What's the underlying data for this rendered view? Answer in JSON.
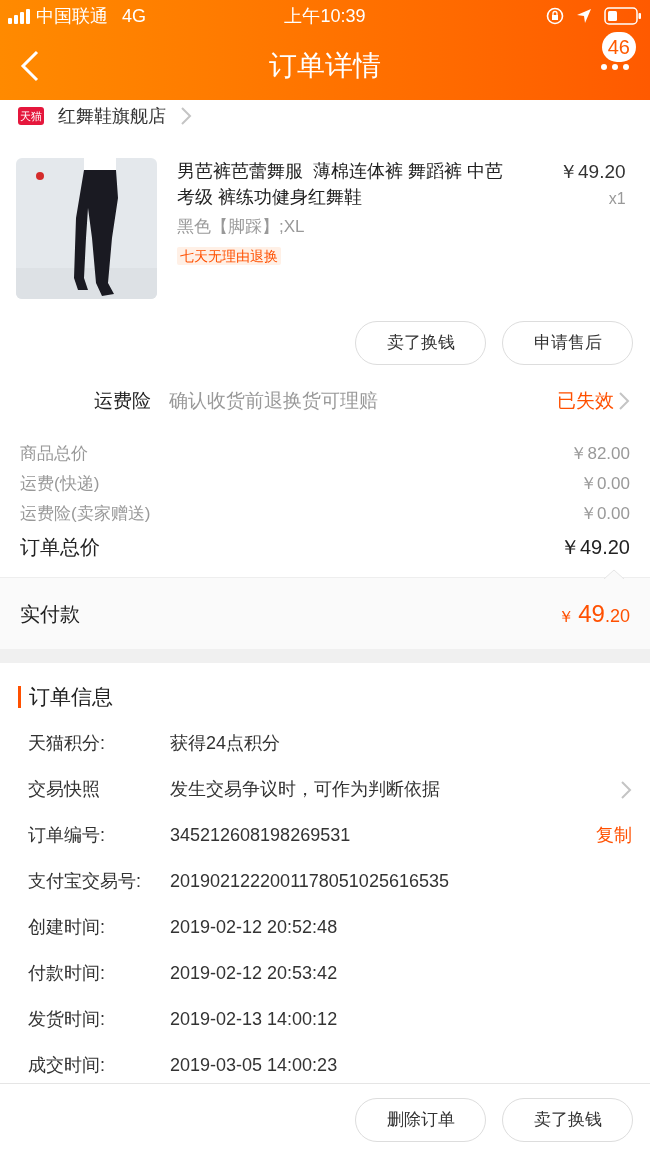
{
  "status_bar": {
    "carrier": "中国联通",
    "network": "4G",
    "time": "上午10:39"
  },
  "nav": {
    "title": "订单详情",
    "badge": "46"
  },
  "store": {
    "badge": "天猫",
    "name": "红舞鞋旗舰店"
  },
  "product": {
    "kind": "picture",
    "title": "男芭裤芭蕾舞服  薄棉连体裤 舞蹈裤 中芭考级 裤练功健身红舞鞋",
    "price": "￥49.20",
    "quantity": "x1",
    "variant": "黑色【脚踩】;XL",
    "tag": "七天无理由退换"
  },
  "item_buttons": [
    "卖了换钱",
    "申请售后"
  ],
  "insurance": {
    "label": "运费险",
    "text": "确认收货前退换货可理赔",
    "status": "已失效"
  },
  "costs": [
    {
      "label": "商品总价",
      "value": "￥82.00"
    },
    {
      "label": "运费(快递)",
      "value": "￥0.00"
    },
    {
      "label": "运费险(卖家赠送)",
      "value": "￥0.00"
    }
  ],
  "total": {
    "label": "订单总价",
    "value": "￥49.20"
  },
  "paid": {
    "label": "实付款",
    "currency": "￥",
    "integer": "49",
    "decimal": ".20"
  },
  "order_info": {
    "title": "订单信息",
    "rows": [
      {
        "label": "天猫积分:",
        "value": "获得24点积分"
      },
      {
        "label": "交易快照",
        "value": "发生交易争议时，可作为判断依据",
        "kind": "link"
      },
      {
        "label": "订单编号:",
        "value": "345212608198269531",
        "action": "复制"
      },
      {
        "label": "支付宝交易号:",
        "value": "2019021222001178051025616535"
      },
      {
        "label": "创建时间:",
        "value": "2019-02-12 20:52:48"
      },
      {
        "label": "付款时间:",
        "value": "2019-02-12 20:53:42"
      },
      {
        "label": "发货时间:",
        "value": "2019-02-13 14:00:12"
      },
      {
        "label": "成交时间:",
        "value": "2019-03-05 14:00:23"
      }
    ]
  },
  "bottom_buttons": [
    "删除订单",
    "卖了换钱"
  ]
}
